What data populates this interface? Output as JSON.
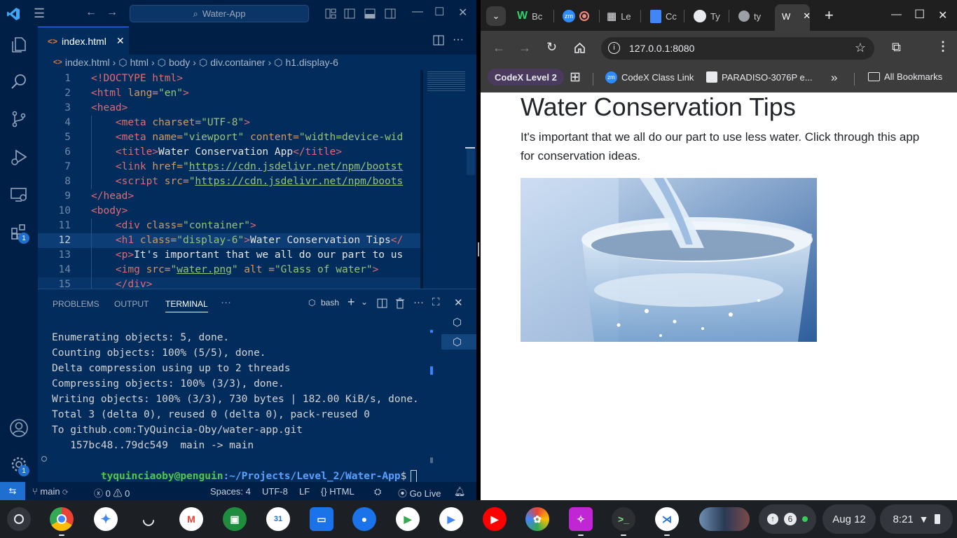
{
  "vscode": {
    "search": "Water-App",
    "tab_label": "index.html",
    "breadcrumb": [
      "index.html",
      "html",
      "body",
      "div.container",
      "h1.display-6"
    ],
    "code_lines": [
      {
        "n": "1"
      },
      {
        "n": "2"
      },
      {
        "n": "3"
      },
      {
        "n": "4"
      },
      {
        "n": "5"
      },
      {
        "n": "6"
      },
      {
        "n": "7"
      },
      {
        "n": "8"
      },
      {
        "n": "9"
      },
      {
        "n": "10"
      },
      {
        "n": "11"
      },
      {
        "n": "12"
      },
      {
        "n": "13"
      },
      {
        "n": "14"
      },
      {
        "n": "15"
      }
    ],
    "code": {
      "l1": "<!DOCTYPE html>",
      "l2a": "<html ",
      "l2b": "lang=",
      "l2c": "\"en\"",
      "l2d": ">",
      "l3": "<head>",
      "l4a": "    <meta ",
      "l4b": "charset=",
      "l4c": "\"UTF-8\"",
      "l4d": ">",
      "l5a": "    <meta ",
      "l5b": "name=",
      "l5c": "\"viewport\"",
      "l5d": " content=",
      "l5e": "\"width=device-wid",
      "l6a": "    <title>",
      "l6b": "Water Conservation App",
      "l6c": "</title>",
      "l7a": "    <link ",
      "l7b": "href=",
      "l7c": "\"",
      "l7d": "https://cdn.jsdelivr.net/npm/bootst",
      "l8a": "    <script ",
      "l8b": "src=",
      "l8c": "\"",
      "l8d": "https://cdn.jsdelivr.net/npm/boots",
      "l9": "</head>",
      "l10": "<body>",
      "l11a": "    <div ",
      "l11b": "class=",
      "l11c": "\"container\"",
      "l11d": ">",
      "l12a": "    <h1 ",
      "l12b": "class=",
      "l12c": "\"display-6\"",
      "l12d": ">",
      "l12e": "Water Conservation Tips",
      "l12f": "</",
      "l13a": "    <p>",
      "l13b": "It's important that we all do our part to us",
      "l14a": "    <img ",
      "l14b": "src=",
      "l14c": "\"",
      "l14d": "water.png",
      "l14e": "\"",
      "l14f": " alt =",
      "l14g": "\"Glass of water\"",
      "l14h": ">",
      "l15": "    </div>"
    },
    "panel_tabs": [
      "PROBLEMS",
      "OUTPUT",
      "TERMINAL"
    ],
    "shell": "bash",
    "terminal_lines": [
      "Enumerating objects: 5, done.",
      "Counting objects: 100% (5/5), done.",
      "Delta compression using up to 2 threads",
      "Compressing objects: 100% (3/3), done.",
      "Writing objects: 100% (3/3), 730 bytes | 182.00 KiB/s, done.",
      "Total 3 (delta 0), reused 0 (delta 0), pack-reused 0",
      "To github.com:TyQuincia-Oby/water-app.git",
      "   157bc48..79dc549  main -> main"
    ],
    "prompt_user": "tyquinciaoby@penguin",
    "prompt_path": ":~/Projects/Level_2/Water-App",
    "prompt_symbol": "$",
    "status": {
      "branch": "main",
      "errors": "0",
      "warnings": "0",
      "spaces": "Spaces: 4",
      "encoding": "UTF-8",
      "eol": "LF",
      "language": "HTML",
      "live": "Go Live"
    },
    "badge_count": "1"
  },
  "chrome": {
    "tabs": [
      {
        "label": "Bc"
      },
      {
        "label": "Le"
      },
      {
        "label": "Cc"
      },
      {
        "label": "Ty"
      },
      {
        "label": "ty"
      },
      {
        "label": "W"
      }
    ],
    "url": "127.0.0.1:8080",
    "bookmarks": {
      "level": "CodeX Level 2",
      "class_link": "CodeX Class Link",
      "paradiso": "PARADISO-3076P e...",
      "all": "All Bookmarks"
    }
  },
  "page": {
    "title": "Water Conservation Tips",
    "text": "It's important that we all do our part to use less water. Click through this app for conservation ideas."
  },
  "shelf": {
    "notif_count": "6",
    "date": "Aug 12",
    "time": "8:21"
  },
  "colors": {
    "vscode_bg": "#022c5c",
    "vscode_accent": "#3b82f6",
    "terminal_prompt_user": "#4ec94e",
    "terminal_prompt_path": "#5aa0ff"
  }
}
